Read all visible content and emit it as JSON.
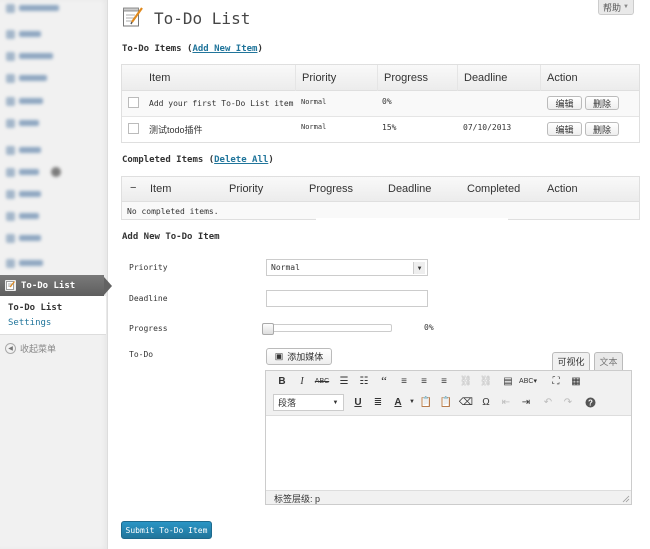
{
  "header": {
    "title": "To-Do List",
    "help_label": "帮助"
  },
  "sidebar": {
    "active_item": "To-Do List",
    "submenu": [
      "To-Do List",
      "Settings"
    ],
    "collapse_label": "收起菜单"
  },
  "todo_section": {
    "heading_prefix": "To-Do Items (",
    "heading_link": "Add New Item",
    "heading_suffix": ")",
    "columns": [
      "Item",
      "Priority",
      "Progress",
      "Deadline",
      "Action"
    ],
    "rows": [
      {
        "item": "Add your first To-Do List item",
        "priority": "Normal",
        "progress": "0%",
        "deadline": "",
        "edit": "编辑",
        "delete": "删除"
      },
      {
        "item": "测试todo插件",
        "priority": "Normal",
        "progress": "15%",
        "deadline": "07/10/2013",
        "edit": "编辑",
        "delete": "删除"
      }
    ]
  },
  "completed_section": {
    "heading_prefix": "Completed Items (",
    "heading_link": "Delete All",
    "heading_suffix": ")",
    "columns": [
      "Item",
      "Priority",
      "Progress",
      "Deadline",
      "Completed",
      "Action"
    ],
    "empty_message": "No completed items."
  },
  "add_form": {
    "heading": "Add New To-Do Item",
    "priority_label": "Priority",
    "priority_value": "Normal",
    "deadline_label": "Deadline",
    "deadline_value": "",
    "progress_label": "Progress",
    "progress_value": "0%",
    "todo_label": "To-Do",
    "add_media": "添加媒体",
    "tab_visual": "可视化",
    "tab_text": "文本",
    "format_select": "段落",
    "status_path": "标签层级: p",
    "submit_label": "Submit To-Do Item"
  }
}
